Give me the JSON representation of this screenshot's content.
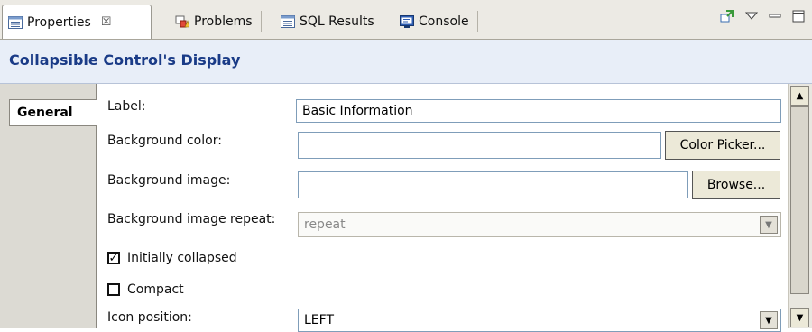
{
  "tabs": [
    {
      "label": "Properties",
      "icon": "properties-icon",
      "active": true,
      "close": "☒"
    },
    {
      "label": "Problems",
      "icon": "problems-icon"
    },
    {
      "label": "SQL Results",
      "icon": "sql-results-icon"
    },
    {
      "label": "Console",
      "icon": "console-icon"
    }
  ],
  "view_actions": [
    "pin-icon",
    "view-menu-icon",
    "minimize-icon",
    "maximize-icon"
  ],
  "header": {
    "title": "Collapsible Control's Display"
  },
  "side_tabs": [
    {
      "label": "General"
    }
  ],
  "form": {
    "label": {
      "label": "Label:",
      "value": "Basic Information"
    },
    "background_color": {
      "label": "Background color:",
      "value": "",
      "button": "Color Picker..."
    },
    "background_image": {
      "label": "Background image:",
      "value": "",
      "button": "Browse..."
    },
    "background_image_repeat": {
      "label": "Background image repeat:",
      "value": "repeat",
      "enabled": false
    },
    "initially_collapsed": {
      "label": "Initially collapsed",
      "checked": true
    },
    "compact": {
      "label": "Compact",
      "checked": false
    },
    "icon_position": {
      "label": "Icon position:",
      "value": "LEFT"
    }
  },
  "colors": {
    "header_text": "#1a3b87",
    "header_bg": "#e8eef8"
  }
}
